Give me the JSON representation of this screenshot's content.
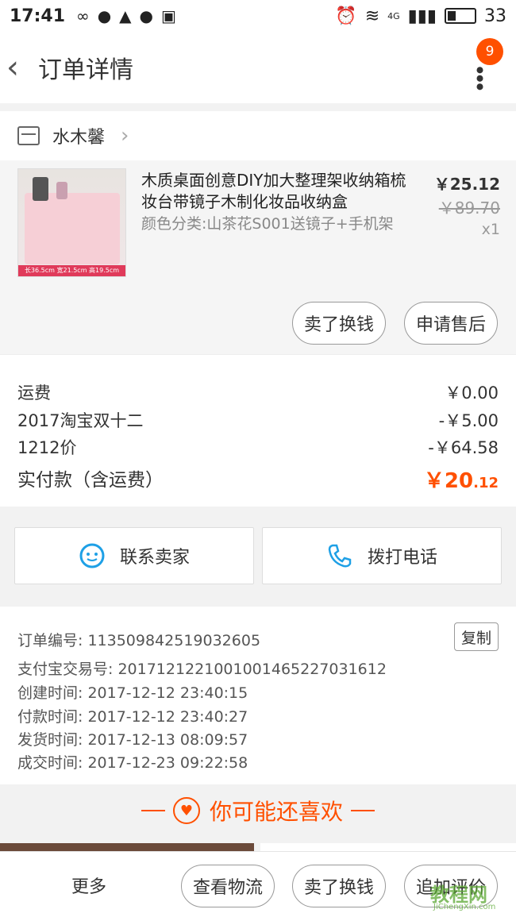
{
  "status_bar": {
    "time": "17:41",
    "network": "4G",
    "battery": "33"
  },
  "header": {
    "title": "订单详情",
    "badge_count": "9"
  },
  "shop": {
    "name": "水木馨"
  },
  "product": {
    "title": "木质桌面创意DIY加大整理架收纳箱梳妆台带镜子木制化妆品收纳盒",
    "sku": "颜色分类:山茶花S001送镜子+手机架",
    "price": "￥25.12",
    "original_price": "￥89.70",
    "quantity": "x1",
    "image_caption": "长36.5cm  宽21.5cm  高19.5cm",
    "actions": [
      "卖了换钱",
      "申请售后"
    ]
  },
  "fees": [
    {
      "label": "运费",
      "value": "￥0.00"
    },
    {
      "label": "2017淘宝双十二",
      "value": "-￥5.00"
    },
    {
      "label": "1212价",
      "value": "-￥64.58"
    }
  ],
  "total": {
    "label": "实付款（含运费）",
    "symbol": "￥",
    "integer": "20",
    "decimal": ".12"
  },
  "contact": {
    "seller": "联系卖家",
    "call": "拨打电话"
  },
  "order_info": {
    "order_no": "订单编号: 113509842519032605",
    "copy": "复制",
    "alipay_no": "支付宝交易号: 2017121221001001465227031612",
    "created": "创建时间: 2017-12-12 23:40:15",
    "paid": "付款时间: 2017-12-12 23:40:27",
    "shipped": "发货时间: 2017-12-13 08:09:57",
    "completed": "成交时间: 2017-12-23 09:22:58"
  },
  "recommend": {
    "title": "你可能还喜欢"
  },
  "bottom_bar": {
    "more": "更多",
    "buttons": [
      "查看物流",
      "卖了换钱",
      "追加评价"
    ]
  },
  "watermark": {
    "text": "教程网",
    "url": "JiChengXin.com"
  },
  "colors": {
    "accent": "#ff5000",
    "link_blue": "#1ea0e6"
  }
}
